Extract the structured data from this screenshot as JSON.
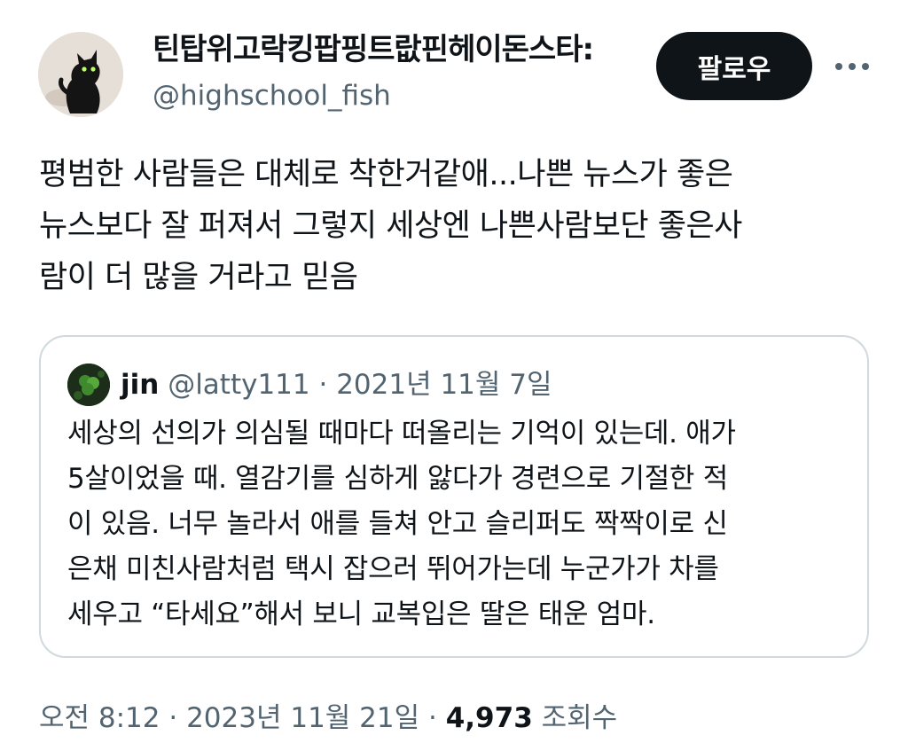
{
  "author": {
    "display_name": "틴탑위고락킹팝핑트랎핀헤이돈스타:",
    "handle": "@highschool_fish",
    "avatar_icon": "black-cat-avatar"
  },
  "actions": {
    "follow_label": "팔로우",
    "more_icon": "more-horizontal-icon"
  },
  "tweet": {
    "lines": [
      "평범한 사람들은 대체로 착한거같애...나쁜 뉴스가 좋은",
      "뉴스보다 잘 퍼져서 그렇지 세상엔 나쁜사람보단 좋은사",
      "람이 더 많을 거라고 믿음"
    ]
  },
  "quote": {
    "name": "jin",
    "handle": "@latty111",
    "separator": " · ",
    "date": "2021년 11월 7일",
    "avatar_icon": "green-clover-avatar",
    "lines": [
      "세상의 선의가 의심될 때마다 떠올리는 기억이 있는데. 애가",
      "5살이었을 때. 열감기를 심하게 앓다가 경련으로 기절한 적",
      "이 있음. 너무 놀라서 애를 들쳐 안고 슬리퍼도 짝짝이로 신",
      "은채 미친사람처럼 택시 잡으러 뛰어가는데 누군가가 차를",
      "세우고 “타세요”해서 보니 교복입은 딸은 태운 엄마."
    ]
  },
  "footer": {
    "time": "오전 8:12",
    "separator": " · ",
    "date": "2023년 11월 21일",
    "views_count": "4,973",
    "views_label": "조회수"
  },
  "colors": {
    "text": "#0f1419",
    "secondary": "#536471",
    "border": "#cfd9de",
    "button_bg": "#0f1419"
  }
}
